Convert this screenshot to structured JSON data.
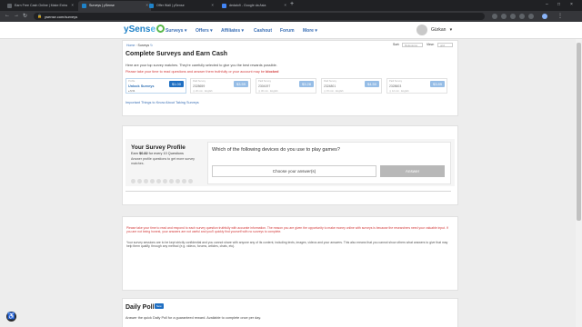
{
  "browser": {
    "tabs": [
      {
        "title": "Earn Free Cash Online | Make Extra"
      },
      {
        "title": "Surveys | ySense"
      },
      {
        "title": "Offer Wall | ySense"
      },
      {
        "title": "dedalo9 - Google da Asia"
      }
    ],
    "new_tab": "+",
    "url": "ysense.com/surveys"
  },
  "site": {
    "logo": {
      "y": "y",
      "s": "Sens",
      "e": "e"
    },
    "nav": [
      {
        "label": "Surveys",
        "caret": "▾"
      },
      {
        "label": "Offers",
        "caret": "▾"
      },
      {
        "label": "Affiliates",
        "caret": "▾"
      },
      {
        "label": "Cashout",
        "caret": ""
      },
      {
        "label": "Forum",
        "caret": ""
      },
      {
        "label": "More",
        "caret": "▾"
      }
    ],
    "user": {
      "name": "Gürkan",
      "caret": "▾"
    }
  },
  "surveys_card": {
    "breadcrumb": {
      "home": "Home",
      "sep": "›",
      "current": "Surveys"
    },
    "sort_label": "Sort:",
    "sort_value": "Relevance",
    "view_label": "View:",
    "view_value": "grid",
    "title": "Complete Surveys and Earn Cash",
    "subtitle": "Here are your top survey matches. They're carefully selected to give you the best rewards possible.",
    "warning": "Please take your time to read questions and answer them truthfully or your account may be",
    "warning_bold": "blocked",
    "surveys": [
      {
        "tag": "Profile",
        "id": "Unlock Surveys",
        "meta": "● $.54",
        "price": "$1.00"
      },
      {
        "tag": "Paid Survey",
        "id": "2328659",
        "meta": "◷ 20 min · English",
        "price": "$3.59"
      },
      {
        "tag": "Paid Survey",
        "id": "2304197",
        "meta": "◷ 30 min · English",
        "price": "$3.28"
      },
      {
        "tag": "Paid Survey",
        "id": "2324801",
        "meta": "◷ 15 min · English",
        "price": "$4.50"
      },
      {
        "tag": "Paid Survey",
        "id": "2328603",
        "meta": "◷ 12 min · English",
        "price": "$3.89"
      }
    ],
    "important_link": "Important Things to Know About Taking Surveys"
  },
  "profile": {
    "title": "Your Survey Profile",
    "earn_prefix": "Earn",
    "earn_amount": "$0.82",
    "earn_suffix": "for every 10 Questions",
    "text": "Answer profile questions to get more survey matches.",
    "question": "Which of the following devices do you use to play games?",
    "select_placeholder": "Choose your answer(s)",
    "answer_button": "Answer"
  },
  "notice": {
    "red": "Please take your time to read and respond to each survey question truthfully with accurate information. The reason you are given the opportunity to make money online with surveys is because the researchers need your valuable input. If you are not being honest, your answers are not useful and you'll quickly find yourself with no surveys to complete.",
    "gray": "Your survey sessions are to be kept strictly confidential and you cannot share with anyone any of its content, including texts, images, videos and your answers. This also means that you cannot show others what answers to give that may help them qualify, through any method (e.g. videos, forums, articles, chats, etc)."
  },
  "poll": {
    "title": "Daily Poll",
    "badge": "New",
    "subtitle": "Answer the quick Daily Poll for a guaranteed reward. Available to complete once per day."
  }
}
